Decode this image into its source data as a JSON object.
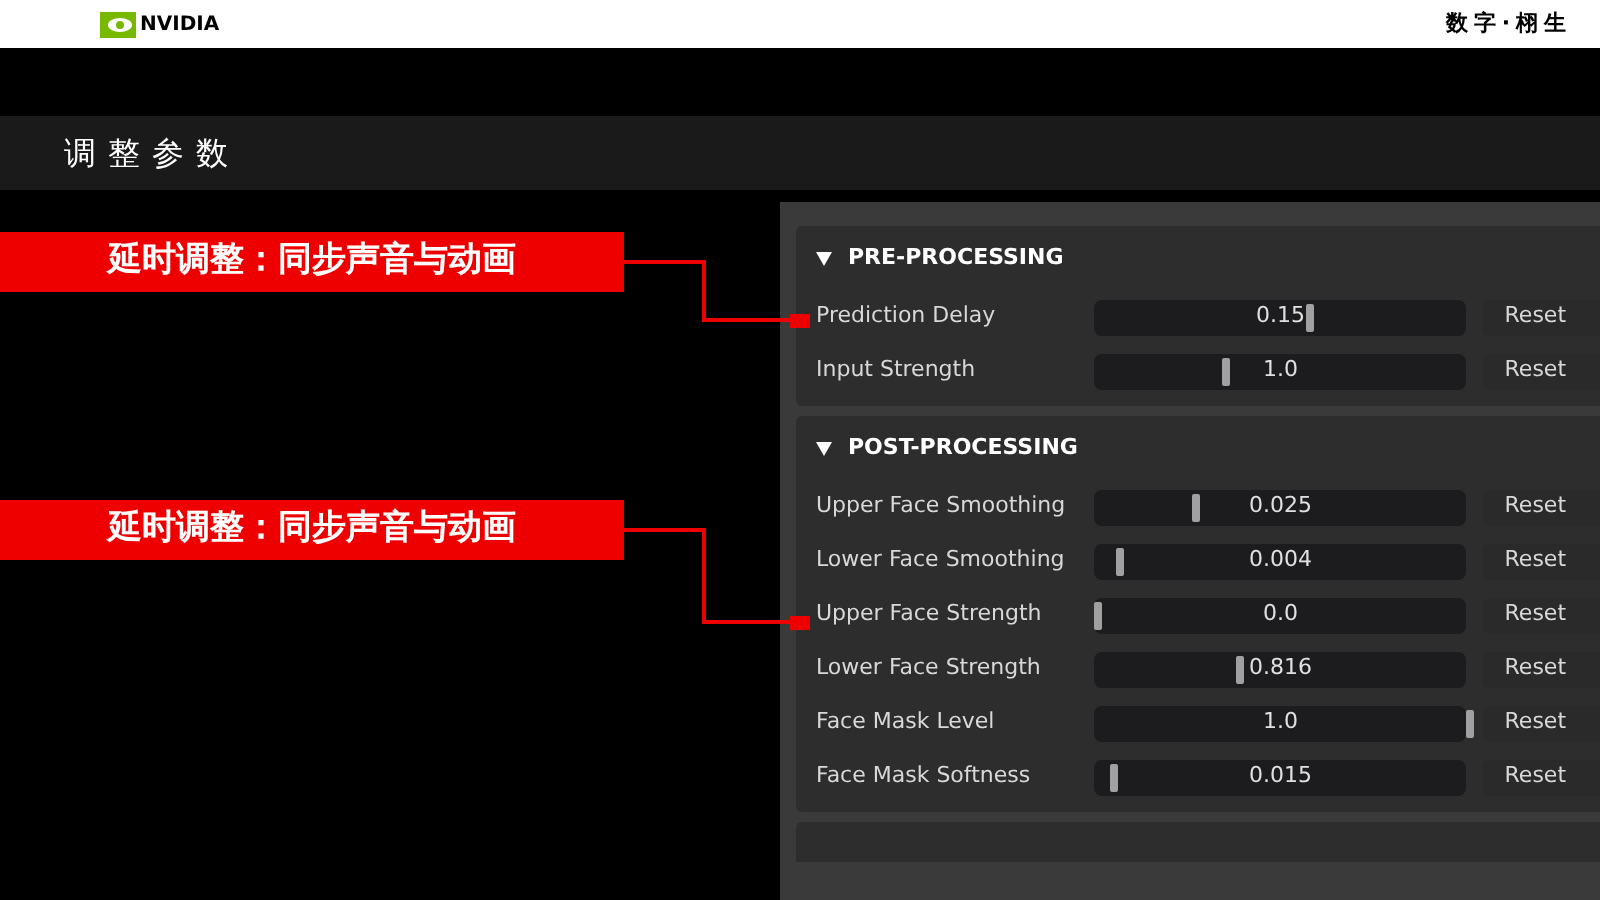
{
  "header": {
    "brand": "NVIDIA",
    "tagline": "数字·栩生"
  },
  "title": "调整参数",
  "callouts": [
    "延时调整：同步声音与动画",
    "延时调整：同步声音与动画"
  ],
  "sections": [
    {
      "title": "PRE-PROCESSING",
      "expanded": true,
      "rows": [
        {
          "label": "Prediction Delay",
          "value": "0.15",
          "level": 0.57,
          "button": "Reset"
        },
        {
          "label": "Input Strength",
          "value": "1.0",
          "level": 0.34,
          "button": "Reset"
        }
      ]
    },
    {
      "title": "POST-PROCESSING",
      "expanded": true,
      "rows": [
        {
          "label": "Upper Face Smoothing",
          "value": "0.025",
          "level": 0.26,
          "button": "Reset"
        },
        {
          "label": "Lower Face Smoothing",
          "value": "0.004",
          "level": 0.06,
          "button": "Reset"
        },
        {
          "label": "Upper Face Strength",
          "value": "0.0",
          "level": 0.0,
          "button": "Reset"
        },
        {
          "label": "Lower Face Strength",
          "value": "0.816",
          "level": 0.38,
          "button": "Reset"
        },
        {
          "label": "Face Mask Level",
          "value": "1.0",
          "level": 1.0,
          "button": "Reset"
        },
        {
          "label": "Face Mask Softness",
          "value": "0.015",
          "level": 0.04,
          "button": "Reset"
        }
      ]
    }
  ]
}
